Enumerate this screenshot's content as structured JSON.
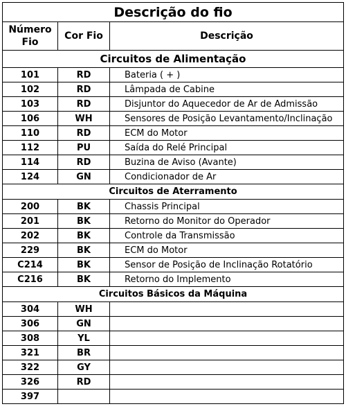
{
  "title": "Descrição do fio",
  "headers": {
    "numero": "Número Fio",
    "cor": "Cor Fio",
    "descricao": "Descrição"
  },
  "sections": [
    {
      "title": "Circuitos de Alimentação",
      "rows": [
        {
          "num": "101",
          "cor": "RD",
          "desc": "Bateria ( + )"
        },
        {
          "num": "102",
          "cor": "RD",
          "desc": "Lâmpada de Cabine"
        },
        {
          "num": "103",
          "cor": "RD",
          "desc": "Disjuntor do Aquecedor de Ar de Admissão"
        },
        {
          "num": "106",
          "cor": "WH",
          "desc": "Sensores de Posição Levantamento/Inclinação"
        },
        {
          "num": "110",
          "cor": "RD",
          "desc": "ECM do Motor"
        },
        {
          "num": "112",
          "cor": "PU",
          "desc": "Saída do Relé Principal"
        },
        {
          "num": "114",
          "cor": "RD",
          "desc": "Buzina de Aviso (Avante)"
        },
        {
          "num": "124",
          "cor": "GN",
          "desc": "Condicionador de Ar"
        }
      ]
    },
    {
      "title": "Circuitos de Aterramento",
      "rows": [
        {
          "num": "200",
          "cor": "BK",
          "desc": "Chassis Principal"
        },
        {
          "num": "201",
          "cor": "BK",
          "desc": "Retorno do Monitor do Operador"
        },
        {
          "num": "202",
          "cor": "BK",
          "desc": "Controle da Transmissão"
        },
        {
          "num": "229",
          "cor": "BK",
          "desc": "ECM do Motor"
        },
        {
          "num": "C214",
          "cor": "BK",
          "desc": "Sensor de Posição de Inclinação Rotatório"
        },
        {
          "num": "C216",
          "cor": "BK",
          "desc": "Retorno do Implemento"
        }
      ]
    },
    {
      "title": "Circuitos Básicos da Máquina",
      "rows": [
        {
          "num": "304",
          "cor": "WH",
          "desc": ""
        },
        {
          "num": "306",
          "cor": "GN",
          "desc": ""
        },
        {
          "num": "308",
          "cor": "YL",
          "desc": ""
        },
        {
          "num": "321",
          "cor": "BR",
          "desc": ""
        },
        {
          "num": "322",
          "cor": "GY",
          "desc": ""
        },
        {
          "num": "326",
          "cor": "RD",
          "desc": ""
        },
        {
          "num": "397",
          "cor": "",
          "desc": ""
        }
      ]
    }
  ]
}
